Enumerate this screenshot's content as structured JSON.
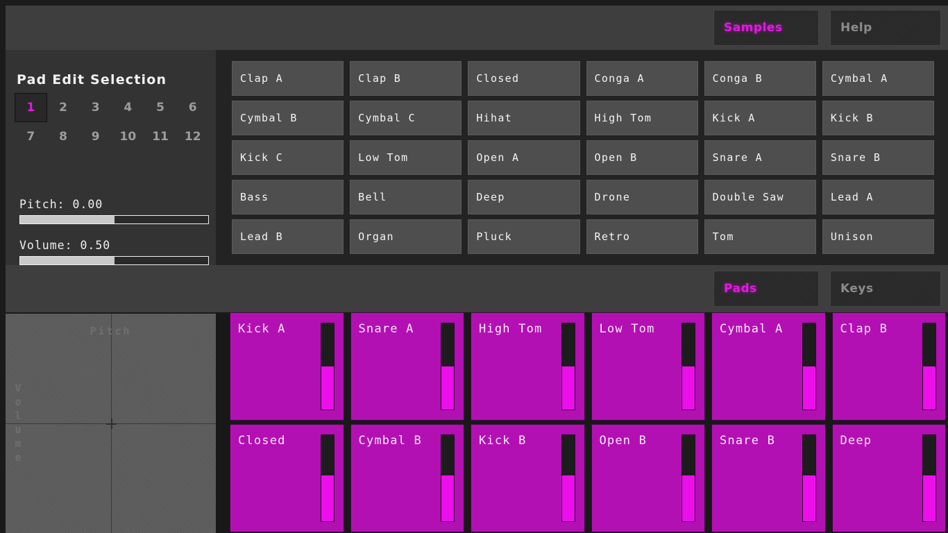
{
  "top_tabs": [
    {
      "label": "Samples",
      "active": true
    },
    {
      "label": "Help",
      "active": false
    }
  ],
  "mid_tabs": [
    {
      "label": "Pads",
      "active": true
    },
    {
      "label": "Keys",
      "active": false
    }
  ],
  "edit_panel": {
    "title": "Pad Edit Selection",
    "pad_numbers_row1": [
      "1",
      "2",
      "3",
      "4",
      "5",
      "6"
    ],
    "pad_numbers_row2": [
      "7",
      "8",
      "9",
      "10",
      "11",
      "12"
    ],
    "selected_pad": "1",
    "pitch": {
      "label": "Pitch: 0.00",
      "value": 0.0,
      "fill_percent": 50
    },
    "volume": {
      "label": "Volume: 0.50",
      "value": 0.5,
      "fill_percent": 50
    }
  },
  "samples": [
    "Clap A",
    "Clap B",
    "Closed",
    "Conga A",
    "Conga B",
    "Cymbal A",
    "Cymbal B",
    "Cymbal C",
    "Hihat",
    "High Tom",
    "Kick A",
    "Kick B",
    "Kick C",
    "Low Tom",
    "Open A",
    "Open B",
    "Snare A",
    "Snare B",
    "Bass",
    "Bell",
    "Deep",
    "Drone",
    "Double Saw",
    "Lead A",
    "Lead B",
    "Organ",
    "Pluck",
    "Retro",
    "Tom",
    "Unison"
  ],
  "xy_pad": {
    "x_label": "Pitch",
    "y_label": "Volume",
    "cursor_x_percent": 50,
    "cursor_y_percent": 50
  },
  "performance_pads": [
    {
      "label": "Kick A",
      "meter_percent": 50
    },
    {
      "label": "Snare A",
      "meter_percent": 50
    },
    {
      "label": "High Tom",
      "meter_percent": 50
    },
    {
      "label": "Low Tom",
      "meter_percent": 50
    },
    {
      "label": "Cymbal A",
      "meter_percent": 50
    },
    {
      "label": "Clap B",
      "meter_percent": 50
    },
    {
      "label": "Closed",
      "meter_percent": 53
    },
    {
      "label": "Cymbal B",
      "meter_percent": 53
    },
    {
      "label": "Kick B",
      "meter_percent": 53
    },
    {
      "label": "Open B",
      "meter_percent": 53
    },
    {
      "label": "Snare B",
      "meter_percent": 53
    },
    {
      "label": "Deep",
      "meter_percent": 53
    }
  ],
  "colors": {
    "accent": "#e616e6",
    "pad_base": "#b310b3",
    "pad_meter": "#ec0fec",
    "panel_dark": "#232323",
    "panel_mid": "#333333",
    "toolbar": "#3e3e3e"
  }
}
